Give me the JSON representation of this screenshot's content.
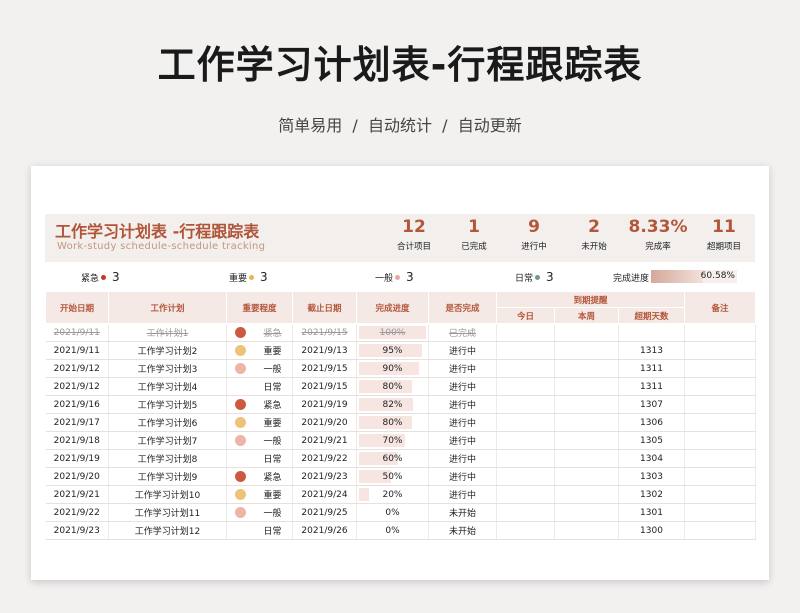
{
  "header": {
    "title": "工作学习计划表-行程跟踪表",
    "subtitle": "简单易用  /  自动统计  /  自动更新"
  },
  "banner": {
    "title": "工作学习计划表 -行程跟踪表",
    "subtitle": "Work-study schedule-schedule tracking"
  },
  "stats": [
    {
      "value": "12",
      "label": "合计项目"
    },
    {
      "value": "1",
      "label": "已完成"
    },
    {
      "value": "9",
      "label": "进行中"
    },
    {
      "value": "2",
      "label": "未开始"
    },
    {
      "value": "8.33%",
      "label": "完成率"
    },
    {
      "value": "11",
      "label": "超期项目"
    }
  ],
  "legend": {
    "items": [
      {
        "label": "紧急",
        "count": "3",
        "color": "#c0392b"
      },
      {
        "label": "重要",
        "count": "3",
        "color": "#e8b84a"
      },
      {
        "label": "一般",
        "count": "3",
        "color": "#e6aaa0"
      },
      {
        "label": "日常",
        "count": "3",
        "color": "#6f9a86"
      }
    ],
    "progress_label": "完成进度",
    "progress_value": 0.6058,
    "progress_text": "60.58%"
  },
  "columns": {
    "start": "开始日期",
    "plan": "工作计划",
    "priority": "重要程度",
    "end": "截止日期",
    "progress": "完成进度",
    "status": "是否完成",
    "reminder": "到期提醒",
    "today": "今日",
    "week": "本周",
    "overdue_days": "超期天数",
    "note": "备注"
  },
  "priority_colors": {
    "紧急": "#cc5a3f",
    "重要": "#efc27a",
    "一般": "#ecb5a8",
    "日常": ""
  },
  "rows": [
    {
      "start": "2021/9/11",
      "plan": "工作计划1",
      "priority": "紧急",
      "end": "2021/9/15",
      "progress": "100%",
      "pct": 1.0,
      "status": "已完成",
      "overdue": "",
      "done": true
    },
    {
      "start": "2021/9/11",
      "plan": "工作学习计划2",
      "priority": "重要",
      "end": "2021/9/13",
      "progress": "95%",
      "pct": 0.95,
      "status": "进行中",
      "overdue": "1313",
      "done": false
    },
    {
      "start": "2021/9/12",
      "plan": "工作学习计划3",
      "priority": "一般",
      "end": "2021/9/15",
      "progress": "90%",
      "pct": 0.9,
      "status": "进行中",
      "overdue": "1311",
      "done": false
    },
    {
      "start": "2021/9/12",
      "plan": "工作学习计划4",
      "priority": "日常",
      "end": "2021/9/15",
      "progress": "80%",
      "pct": 0.8,
      "status": "进行中",
      "overdue": "1311",
      "done": false
    },
    {
      "start": "2021/9/16",
      "plan": "工作学习计划5",
      "priority": "紧急",
      "end": "2021/9/19",
      "progress": "82%",
      "pct": 0.82,
      "status": "进行中",
      "overdue": "1307",
      "done": false
    },
    {
      "start": "2021/9/17",
      "plan": "工作学习计划6",
      "priority": "重要",
      "end": "2021/9/20",
      "progress": "80%",
      "pct": 0.8,
      "status": "进行中",
      "overdue": "1306",
      "done": false
    },
    {
      "start": "2021/9/18",
      "plan": "工作学习计划7",
      "priority": "一般",
      "end": "2021/9/21",
      "progress": "70%",
      "pct": 0.7,
      "status": "进行中",
      "overdue": "1305",
      "done": false
    },
    {
      "start": "2021/9/19",
      "plan": "工作学习计划8",
      "priority": "日常",
      "end": "2021/9/22",
      "progress": "60%",
      "pct": 0.6,
      "status": "进行中",
      "overdue": "1304",
      "done": false
    },
    {
      "start": "2021/9/20",
      "plan": "工作学习计划9",
      "priority": "紧急",
      "end": "2021/9/23",
      "progress": "50%",
      "pct": 0.5,
      "status": "进行中",
      "overdue": "1303",
      "done": false
    },
    {
      "start": "2021/9/21",
      "plan": "工作学习计划10",
      "priority": "重要",
      "end": "2021/9/24",
      "progress": "20%",
      "pct": 0.2,
      "status": "进行中",
      "overdue": "1302",
      "done": false
    },
    {
      "start": "2021/9/22",
      "plan": "工作学习计划11",
      "priority": "一般",
      "end": "2021/9/25",
      "progress": "0%",
      "pct": 0.0,
      "status": "未开始",
      "overdue": "1301",
      "done": false
    },
    {
      "start": "2021/9/23",
      "plan": "工作学习计划12",
      "priority": "日常",
      "end": "2021/9/26",
      "progress": "0%",
      "pct": 0.0,
      "status": "未开始",
      "overdue": "1300",
      "done": false
    }
  ]
}
